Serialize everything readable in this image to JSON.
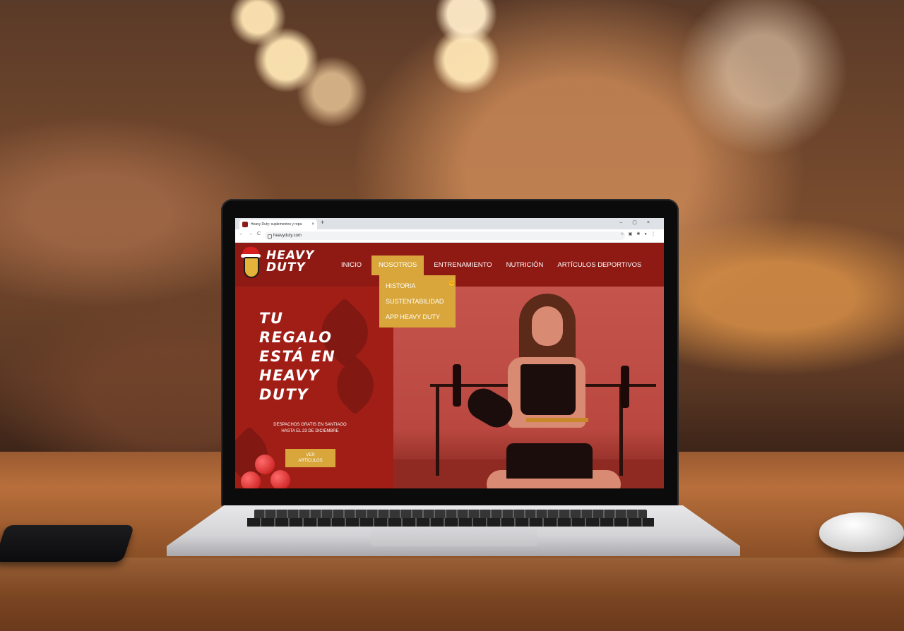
{
  "browser": {
    "tab_title": "Heavy Duty: suplementos y ropa",
    "tab_close": "×",
    "new_tab": "+",
    "window_controls": "–▢×",
    "nav_buttons": "←→C",
    "url": "heavyduty.com",
    "extensions": "☆▣✱●⋮"
  },
  "site": {
    "brand_line1": "HEAVY",
    "brand_line2": "DUTY",
    "nav": [
      {
        "label": "INICIO"
      },
      {
        "label": "NOSOTROS"
      },
      {
        "label": "ENTRENAMIENTO"
      },
      {
        "label": "NUTRICIÓN"
      },
      {
        "label": "ARTÍCULOS DEPORTIVOS"
      }
    ],
    "dropdown": [
      {
        "label": "HISTORIA"
      },
      {
        "label": "SUSTENTABILIDAD"
      },
      {
        "label": "APP HEAVY DUTY"
      }
    ],
    "hero": {
      "title_lines": [
        "TU",
        "REGALO",
        "ESTÁ EN",
        "HEAVY",
        "DUTY"
      ],
      "sub_line1": "DESPACHOS GRATIS EN SANTIAGO",
      "sub_line2": "HASTA EL 23 DE DICIEMBRE",
      "cta_line1": "VER",
      "cta_line2": "ARTÍCULOS"
    }
  },
  "colors": {
    "header_red": "#8f1a14",
    "hero_red": "#a31e17",
    "accent_gold": "#d8a63a"
  }
}
